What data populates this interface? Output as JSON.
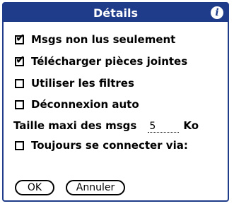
{
  "dialog": {
    "title": "Détails",
    "info_icon_glyph": "i",
    "title_color": "#1f3c8a"
  },
  "options": [
    {
      "label": "Msgs non lus seulement",
      "checked": true,
      "check_glyph": "✔"
    },
    {
      "label": "Télécharger pièces jointes",
      "checked": true,
      "check_glyph": "✔"
    },
    {
      "label": "Utiliser les filtres",
      "checked": false,
      "check_glyph": ""
    },
    {
      "label": "Déconnexion auto",
      "checked": false,
      "check_glyph": ""
    }
  ],
  "max_size": {
    "label": "Taille maxi des msgs",
    "value": "5",
    "unit": "Ko"
  },
  "connect_via": {
    "label": "Toujours se connecter via:",
    "checked": false
  },
  "buttons": {
    "ok_label": "OK",
    "cancel_label": "Annuler"
  }
}
